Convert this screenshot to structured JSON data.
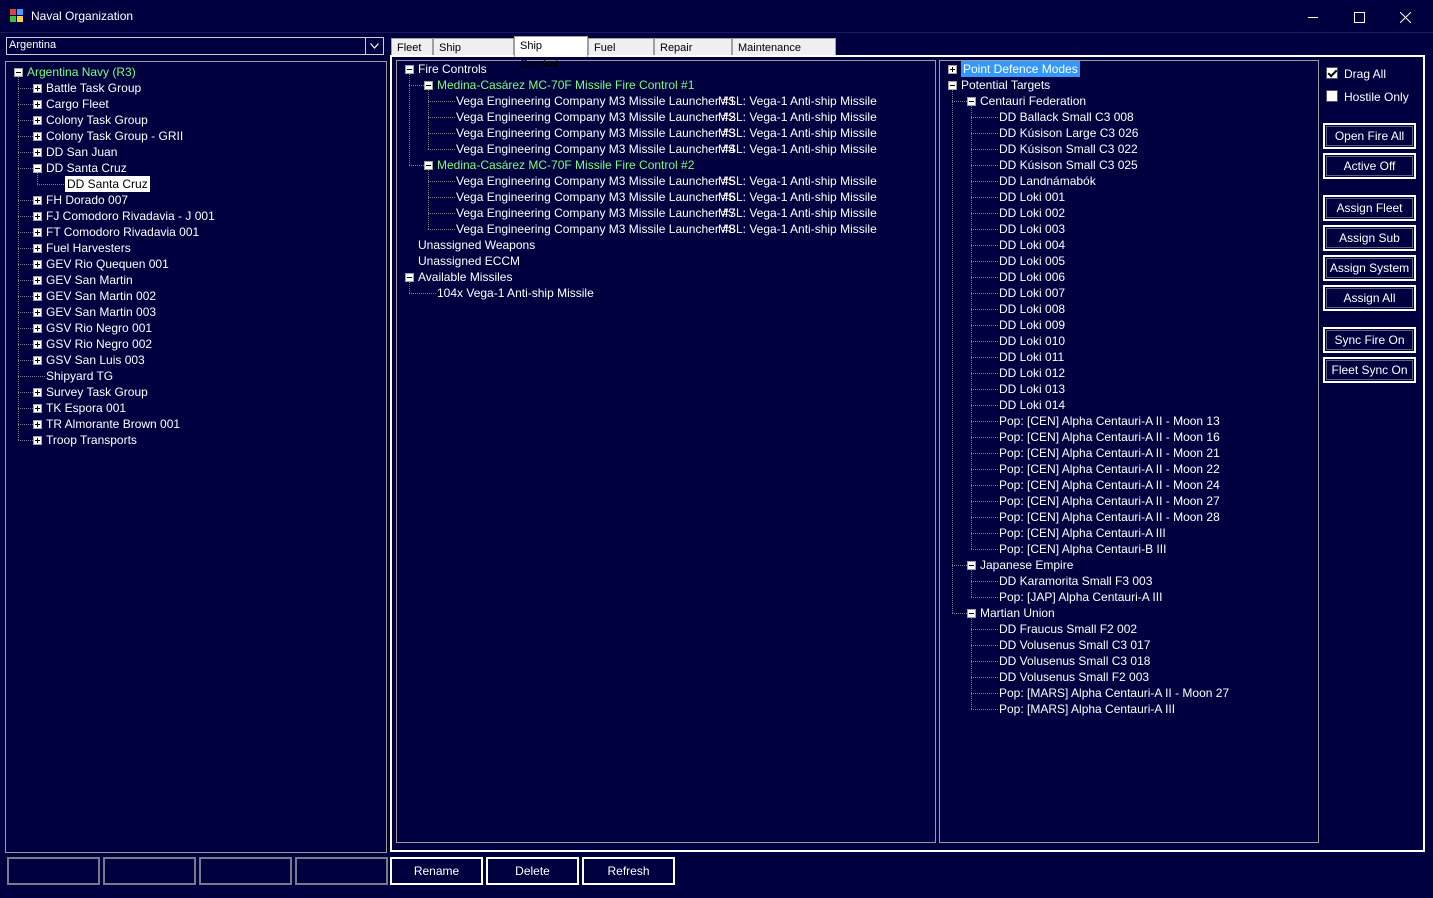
{
  "window": {
    "title": "Naval Organization"
  },
  "race_select": {
    "value": "Argentina"
  },
  "fleet_tree": [
    {
      "label": "Argentina Navy  (R3)",
      "level": 0,
      "expand": "minus",
      "green": true
    },
    {
      "label": "Battle Task Group",
      "level": 1,
      "expand": "plus"
    },
    {
      "label": "Cargo Fleet",
      "level": 1,
      "expand": "plus"
    },
    {
      "label": "Colony Task Group",
      "level": 1,
      "expand": "plus"
    },
    {
      "label": "Colony Task Group - GRII",
      "level": 1,
      "expand": "plus"
    },
    {
      "label": "DD San Juan",
      "level": 1,
      "expand": "plus"
    },
    {
      "label": "DD Santa Cruz",
      "level": 1,
      "expand": "minus"
    },
    {
      "label": "DD Santa Cruz",
      "level": 2,
      "expand": "none",
      "selected": true
    },
    {
      "label": "FH Dorado 007",
      "level": 1,
      "expand": "plus"
    },
    {
      "label": "FJ Comodoro Rivadavia - J 001",
      "level": 1,
      "expand": "plus"
    },
    {
      "label": "FT Comodoro Rivadavia 001",
      "level": 1,
      "expand": "plus"
    },
    {
      "label": "Fuel Harvesters",
      "level": 1,
      "expand": "plus"
    },
    {
      "label": "GEV Rio Quequen 001",
      "level": 1,
      "expand": "plus"
    },
    {
      "label": "GEV San Martin",
      "level": 1,
      "expand": "plus"
    },
    {
      "label": "GEV San Martin 002",
      "level": 1,
      "expand": "plus"
    },
    {
      "label": "GEV San Martin 003",
      "level": 1,
      "expand": "plus"
    },
    {
      "label": "GSV Rio Negro 001",
      "level": 1,
      "expand": "plus"
    },
    {
      "label": "GSV Rio Negro 002",
      "level": 1,
      "expand": "plus"
    },
    {
      "label": "GSV San Luis 003",
      "level": 1,
      "expand": "plus"
    },
    {
      "label": "Shipyard TG",
      "level": 1,
      "expand": "none"
    },
    {
      "label": "Survey Task Group",
      "level": 1,
      "expand": "plus"
    },
    {
      "label": "TK Espora 001",
      "level": 1,
      "expand": "plus"
    },
    {
      "label": "TR Almorante Brown 001",
      "level": 1,
      "expand": "plus"
    },
    {
      "label": "Troop Transports",
      "level": 1,
      "expand": "plus"
    }
  ],
  "tabs": [
    {
      "label": "Fleet"
    },
    {
      "label": "Ship Overview"
    },
    {
      "label": "Ship Combat",
      "active": true
    },
    {
      "label": "Fuel Report"
    },
    {
      "label": "Repair Report"
    },
    {
      "label": "Maintenance Report"
    }
  ],
  "fire_tree": [
    {
      "label": "Fire Controls",
      "level": 0,
      "expand": "minus"
    },
    {
      "label": "Medina-Casárez MC-70F Missile Fire Control #1",
      "level": 1,
      "expand": "minus",
      "green": true
    },
    {
      "label": "Vega Engineering Company M3 Missile Launcher #1",
      "level": 2,
      "expand": "none",
      "missile": "MSL: Vega-1 Anti-ship Missile"
    },
    {
      "label": "Vega Engineering Company M3 Missile Launcher #2",
      "level": 2,
      "expand": "none",
      "missile": "MSL: Vega-1 Anti-ship Missile"
    },
    {
      "label": "Vega Engineering Company M3 Missile Launcher #3",
      "level": 2,
      "expand": "none",
      "missile": "MSL: Vega-1 Anti-ship Missile"
    },
    {
      "label": "Vega Engineering Company M3 Missile Launcher #4",
      "level": 2,
      "expand": "none",
      "missile": "MSL: Vega-1 Anti-ship Missile"
    },
    {
      "label": "Medina-Casárez MC-70F Missile Fire Control #2",
      "level": 1,
      "expand": "minus",
      "green": true
    },
    {
      "label": "Vega Engineering Company M3 Missile Launcher #5",
      "level": 2,
      "expand": "none",
      "missile": "MSL: Vega-1 Anti-ship Missile"
    },
    {
      "label": "Vega Engineering Company M3 Missile Launcher #6",
      "level": 2,
      "expand": "none",
      "missile": "MSL: Vega-1 Anti-ship Missile"
    },
    {
      "label": "Vega Engineering Company M3 Missile Launcher #7",
      "level": 2,
      "expand": "none",
      "missile": "MSL: Vega-1 Anti-ship Missile"
    },
    {
      "label": "Vega Engineering Company M3 Missile Launcher #8",
      "level": 2,
      "expand": "none",
      "missile": "MSL: Vega-1 Anti-ship Missile"
    },
    {
      "label": "Unassigned Weapons",
      "level": 0,
      "expand": "none"
    },
    {
      "label": "Unassigned ECCM",
      "level": 0,
      "expand": "none"
    },
    {
      "label": "Available Missiles",
      "level": 0,
      "expand": "minus"
    },
    {
      "label": "104x Vega-1 Anti-ship Missile",
      "level": 1,
      "expand": "none"
    }
  ],
  "target_tree": [
    {
      "label": "Point Defence Modes",
      "level": 0,
      "expand": "plus",
      "highlight": true
    },
    {
      "label": "Potential Targets",
      "level": 0,
      "expand": "minus"
    },
    {
      "label": "Centauri Federation",
      "level": 1,
      "expand": "minus"
    },
    {
      "label": "DD Ballack Small C3 008",
      "level": 2,
      "expand": "none"
    },
    {
      "label": "DD Kúsison Large C3 026",
      "level": 2,
      "expand": "none"
    },
    {
      "label": "DD Kúsison Small C3 022",
      "level": 2,
      "expand": "none"
    },
    {
      "label": "DD Kúsison Small C3 025",
      "level": 2,
      "expand": "none"
    },
    {
      "label": "DD Landnámabók",
      "level": 2,
      "expand": "none"
    },
    {
      "label": "DD Loki 001",
      "level": 2,
      "expand": "none"
    },
    {
      "label": "DD Loki 002",
      "level": 2,
      "expand": "none"
    },
    {
      "label": "DD Loki 003",
      "level": 2,
      "expand": "none"
    },
    {
      "label": "DD Loki 004",
      "level": 2,
      "expand": "none"
    },
    {
      "label": "DD Loki 005",
      "level": 2,
      "expand": "none"
    },
    {
      "label": "DD Loki 006",
      "level": 2,
      "expand": "none"
    },
    {
      "label": "DD Loki 007",
      "level": 2,
      "expand": "none"
    },
    {
      "label": "DD Loki 008",
      "level": 2,
      "expand": "none"
    },
    {
      "label": "DD Loki 009",
      "level": 2,
      "expand": "none"
    },
    {
      "label": "DD Loki 010",
      "level": 2,
      "expand": "none"
    },
    {
      "label": "DD Loki 011",
      "level": 2,
      "expand": "none"
    },
    {
      "label": "DD Loki 012",
      "level": 2,
      "expand": "none"
    },
    {
      "label": "DD Loki 013",
      "level": 2,
      "expand": "none"
    },
    {
      "label": "DD Loki 014",
      "level": 2,
      "expand": "none"
    },
    {
      "label": "Pop: [CEN] Alpha Centauri-A II - Moon 13",
      "level": 2,
      "expand": "none"
    },
    {
      "label": "Pop: [CEN] Alpha Centauri-A II - Moon 16",
      "level": 2,
      "expand": "none"
    },
    {
      "label": "Pop: [CEN] Alpha Centauri-A II - Moon 21",
      "level": 2,
      "expand": "none"
    },
    {
      "label": "Pop: [CEN] Alpha Centauri-A II - Moon 22",
      "level": 2,
      "expand": "none"
    },
    {
      "label": "Pop: [CEN] Alpha Centauri-A II - Moon 24",
      "level": 2,
      "expand": "none"
    },
    {
      "label": "Pop: [CEN] Alpha Centauri-A II - Moon 27",
      "level": 2,
      "expand": "none"
    },
    {
      "label": "Pop: [CEN] Alpha Centauri-A II - Moon 28",
      "level": 2,
      "expand": "none"
    },
    {
      "label": "Pop: [CEN] Alpha Centauri-A III",
      "level": 2,
      "expand": "none"
    },
    {
      "label": "Pop: [CEN] Alpha Centauri-B III",
      "level": 2,
      "expand": "none"
    },
    {
      "label": "Japanese Empire",
      "level": 1,
      "expand": "minus"
    },
    {
      "label": "DD Karamorita Small F3 003",
      "level": 2,
      "expand": "none"
    },
    {
      "label": "Pop: [JAP] Alpha Centauri-A III",
      "level": 2,
      "expand": "none"
    },
    {
      "label": "Martian Union",
      "level": 1,
      "expand": "minus"
    },
    {
      "label": "DD Fraucus Small F2 002",
      "level": 2,
      "expand": "none"
    },
    {
      "label": "DD Volusenus Small C3 017",
      "level": 2,
      "expand": "none"
    },
    {
      "label": "DD Volusenus Small C3 018",
      "level": 2,
      "expand": "none"
    },
    {
      "label": "DD Volusenus Small F2 003",
      "level": 2,
      "expand": "none"
    },
    {
      "label": "Pop: [MARS] Alpha Centauri-A II - Moon 27",
      "level": 2,
      "expand": "none"
    },
    {
      "label": "Pop: [MARS] Alpha Centauri-A III",
      "level": 2,
      "expand": "none"
    }
  ],
  "options": {
    "drag_all": {
      "label": "Drag All",
      "checked": true
    },
    "hostile_only": {
      "label": "Hostile Only",
      "checked": false
    }
  },
  "side_buttons": {
    "open_fire_all": "Open Fire All",
    "active_off": "Active Off",
    "assign_fleet": "Assign Fleet",
    "assign_sub_fleet": "Assign Sub Fleet",
    "assign_system": "Assign System",
    "assign_all": "Assign All",
    "sync_fire_on": "Sync Fire On",
    "fleet_sync_on": "Fleet Sync On"
  },
  "bottom_buttons": {
    "rename": "Rename",
    "delete": "Delete",
    "refresh": "Refresh"
  },
  "colors": {
    "background": "#000040",
    "green_text": "#7cff7c",
    "highlight": "#3399ff"
  }
}
